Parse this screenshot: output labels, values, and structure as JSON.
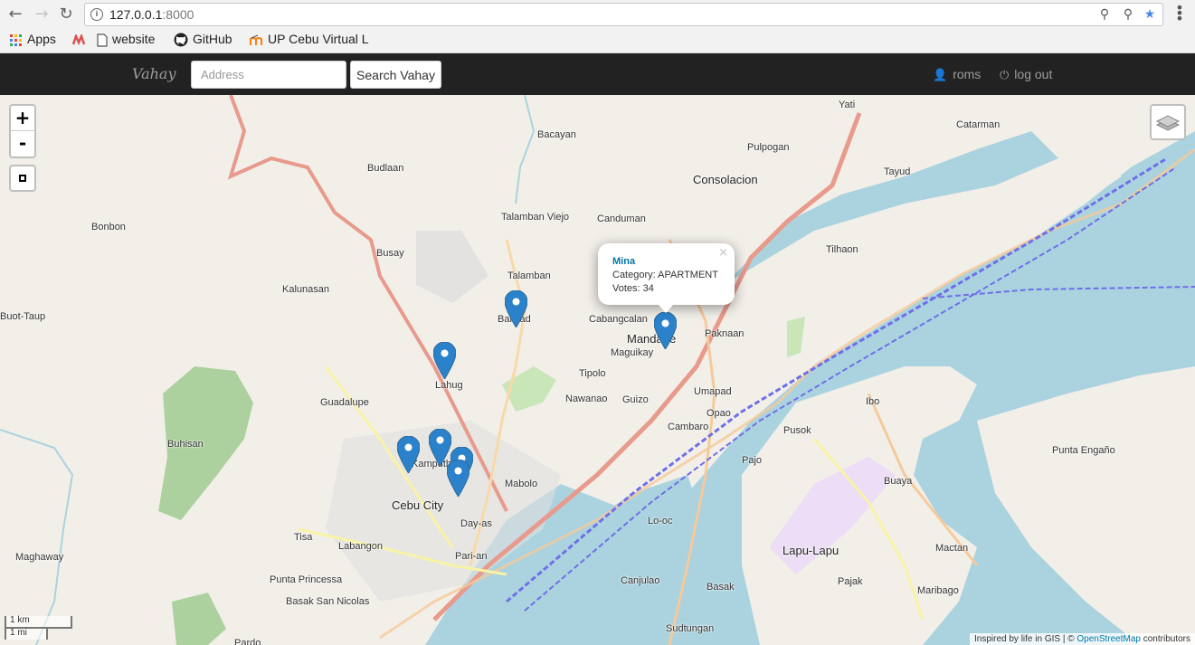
{
  "browser": {
    "url_host": "127.0.0.1",
    "url_port": ":8000",
    "bookmarks": [
      {
        "label": "Apps",
        "icon": "apps-grid-icon"
      },
      {
        "label": "",
        "icon": "mendeley-icon"
      },
      {
        "label": "website",
        "icon": "page-icon"
      },
      {
        "label": "GitHub",
        "icon": "github-icon"
      },
      {
        "label": "UP Cebu Virtual L",
        "icon": "moodle-icon"
      }
    ]
  },
  "navbar": {
    "brand": "Vahay",
    "address_placeholder": "Address",
    "search_label": "Search Vahay",
    "user_label": "roms",
    "logout_label": "log out"
  },
  "map": {
    "zoom_in": "+",
    "zoom_out": "-",
    "popup": {
      "name": "Mina",
      "category": "Category: APARTMENT",
      "votes": "Votes: 34",
      "close": "×"
    },
    "marker_color": "#2b82cb",
    "scale_km": "1 km",
    "scale_mi": "1 mi",
    "attribution_prefix": "Inspired by life in GIS | © ",
    "attribution_link": "OpenStreetMap",
    "attribution_suffix": " contributors",
    "places": [
      "Yati",
      "Catarman",
      "Bacayan",
      "Pulpogan",
      "Budlaan",
      "Consolacion",
      "Tayud",
      "Bonbon",
      "Talamban Viejo",
      "Canduman",
      "Tilhaon",
      "Busay",
      "Talamban",
      "Kalunasan",
      "Buot-Taup",
      "Banilad",
      "Cabangcalan",
      "Mandaue",
      "Paknaan",
      "Maguikay",
      "Tipolo",
      "Lahug",
      "Umapad",
      "Guadalupe",
      "Nawanao",
      "Guizo",
      "Ibo",
      "Opao",
      "Cambaro",
      "Pusok",
      "Buhisan",
      "Kamputhaw",
      "Mabolo",
      "Punta Engaño",
      "Pajo",
      "Buaya",
      "Cebu City",
      "Day-as",
      "Lo-oc",
      "Tisa",
      "Labangon",
      "Maghaway",
      "Pari-an",
      "Lapu-Lapu",
      "Punta Princessa",
      "Canjulao",
      "Mactan",
      "Basak San Nicolas",
      "Basak",
      "Pajak",
      "Maribago",
      "Sudtungan",
      "Pardo"
    ]
  }
}
